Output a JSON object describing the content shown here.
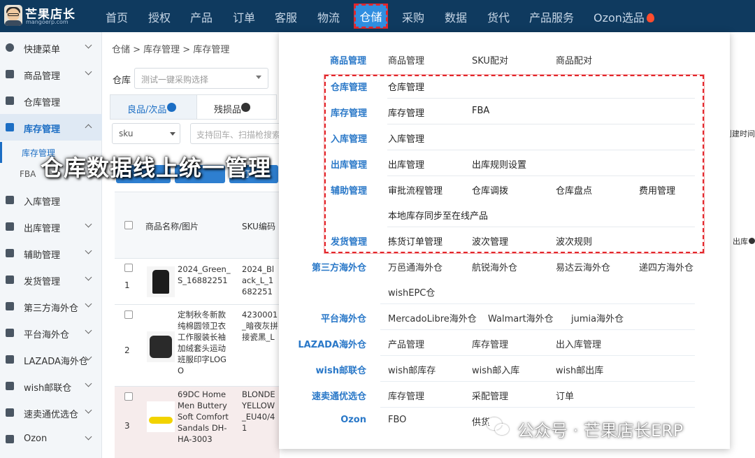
{
  "brand": {
    "title": "芒果店长",
    "subtitle": "mangoerp.com"
  },
  "nav": [
    "首页",
    "授权",
    "产品",
    "订单",
    "客服",
    "物流",
    "仓储",
    "采购",
    "数据",
    "货代",
    "产品服务",
    "Ozon选品"
  ],
  "nav_active": "仓储",
  "sidebar": {
    "items": [
      "快捷菜单",
      "商品管理",
      "仓库管理",
      "库存管理",
      "入库管理",
      "出库管理",
      "辅助管理",
      "发货管理",
      "第三方海外仓",
      "平台海外仓",
      "LAZADA海外仓",
      "wish邮联仓",
      "速卖通优选仓",
      "Ozon"
    ],
    "subitems": [
      "库存管理",
      "FBA"
    ]
  },
  "main": {
    "breadcrumb": "仓储 > 库存管理 > 库存管理",
    "warehouse_label": "仓库",
    "warehouse_placeholder": "测试一键采购选择",
    "tabs": [
      "良品/次品",
      "残损品"
    ],
    "sku_select": "sku",
    "scan_placeholder": "支持回车、扫描枪搜索",
    "print_button": "打",
    "right_text_1": "创建时间",
    "right_text_2": "出库",
    "table": {
      "headers": [
        "商品名称/图片",
        "SKU编码"
      ],
      "rows": [
        {
          "num": "1",
          "name": "2024_Green_S_16882251",
          "sku": "2024_Black_L_1682251"
        },
        {
          "num": "2",
          "name": "定制秋冬新款纯棉圆领卫衣工作服装长袖加绒套头运动班服印字LOGO",
          "sku": "4230001_暗夜灰拼接瓷黑_L"
        },
        {
          "num": "3",
          "name": "69DC Home Men Buttery Soft Comfort Sandals DH-HA-3003",
          "sku": "BLONDE YELLOW_EU40/41"
        }
      ]
    }
  },
  "dropdown": {
    "top": {
      "category": "商品管理",
      "links": [
        "商品管理",
        "SKU配对",
        "商品配对"
      ]
    },
    "highlighted": [
      {
        "category": "仓库管理",
        "links": [
          "仓库管理"
        ]
      },
      {
        "category": "库存管理",
        "links": [
          "库存管理",
          "FBA"
        ]
      },
      {
        "category": "入库管理",
        "links": [
          "入库管理"
        ]
      },
      {
        "category": "出库管理",
        "links": [
          "出库管理",
          "出库规则设置"
        ]
      },
      {
        "category": "辅助管理",
        "links": [
          "审批流程管理",
          "仓库调拨",
          "仓库盘点",
          "费用管理",
          "本地库存同步至在线产品"
        ]
      },
      {
        "category": "发货管理",
        "links": [
          "拣货订单管理",
          "波次管理",
          "波次规则"
        ]
      }
    ],
    "bottom": [
      {
        "category": "第三方海外仓",
        "links": [
          "万邑通海外仓",
          "航锐海外仓",
          "易达云海外仓",
          "递四方海外仓",
          "wishEPC仓"
        ]
      },
      {
        "category": "平台海外仓",
        "links": [
          "MercadoLibre海外仓",
          "Walmart海外仓",
          "jumia海外仓"
        ]
      },
      {
        "category": "LAZADA海外仓",
        "links": [
          "产品管理",
          "库存管理",
          "出入库管理"
        ]
      },
      {
        "category": "wish邮联仓",
        "links": [
          "wish邮库存",
          "wish邮入库",
          "wish邮出库"
        ]
      },
      {
        "category": "速卖通优选仓",
        "links": [
          "库存管理",
          "采配管理",
          "订单"
        ]
      },
      {
        "category": "Ozon",
        "links": [
          "FBO",
          "供货"
        ]
      }
    ]
  },
  "caption": "仓库数据线上统一管理",
  "watermark": "公众号 · 芒果店长ERP",
  "colors": {
    "nav_bg": "#0f3a5f",
    "accent": "#2a78c8",
    "active_nav": "#2f8ee0",
    "highlight_border": "#e3262b"
  },
  "icons": [
    "user-avatar-icon",
    "fire-icon",
    "menu-icon",
    "chevron-down-icon",
    "help-icon",
    "wechat-icon",
    "print-icon"
  ]
}
